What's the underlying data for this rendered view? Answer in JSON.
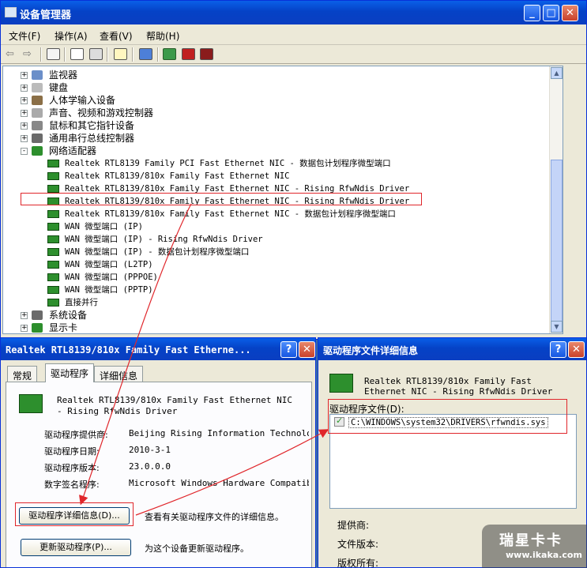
{
  "devmgr": {
    "title": "设备管理器",
    "menus": [
      "文件(F)",
      "操作(A)",
      "查看(V)",
      "帮助(H)"
    ],
    "tree": [
      {
        "label": "监视器",
        "expander": "+"
      },
      {
        "label": "键盘",
        "expander": "+"
      },
      {
        "label": "人体学输入设备",
        "expander": "+"
      },
      {
        "label": "声音、视频和游戏控制器",
        "expander": "+"
      },
      {
        "label": "鼠标和其它指针设备",
        "expander": "+"
      },
      {
        "label": "通用串行总线控制器",
        "expander": "+"
      },
      {
        "label": "网络适配器",
        "expander": "-"
      },
      {
        "label": "Realtek RTL8139 Family PCI Fast Ethernet NIC - 数据包计划程序微型端口"
      },
      {
        "label": "Realtek RTL8139/810x Family Fast Ethernet NIC"
      },
      {
        "label": "Realtek RTL8139/810x Family Fast Ethernet NIC - Rising RfwNdis Driver"
      },
      {
        "label": "Realtek RTL8139/810x Family Fast Ethernet NIC - Rising RfwNdis Driver"
      },
      {
        "label": "Realtek RTL8139/810x Family Fast Ethernet NIC - 数据包计划程序微型端口"
      },
      {
        "label": "WAN 微型端口 (IP)"
      },
      {
        "label": "WAN 微型端口 (IP) - Rising RfwNdis Driver"
      },
      {
        "label": "WAN 微型端口 (IP) - 数据包计划程序微型端口"
      },
      {
        "label": "WAN 微型端口 (L2TP)"
      },
      {
        "label": "WAN 微型端口 (PPPOE)"
      },
      {
        "label": "WAN 微型端口 (PPTP)"
      },
      {
        "label": "直接并行"
      },
      {
        "label": "系统设备",
        "expander": "+"
      },
      {
        "label": "显示卡",
        "expander": "+"
      }
    ]
  },
  "props": {
    "title": "Realtek RTL8139/810x Family Fast Etherne...",
    "tabs": [
      "常规",
      "驱动程序",
      "详细信息"
    ],
    "device_name": "Realtek RTL8139/810x Family Fast Ethernet NIC - Rising RfwNdis Driver",
    "fields": [
      {
        "label": "驱动程序提供商:",
        "value": "Beijing Rising Information Technology"
      },
      {
        "label": "驱动程序日期:",
        "value": "2010-3-1"
      },
      {
        "label": "驱动程序版本:",
        "value": "23.0.0.0"
      },
      {
        "label": "数字签名程序:",
        "value": "Microsoft Windows Hardware Compatibili"
      }
    ],
    "details_button": "驱动程序详细信息(D)...",
    "details_desc": "查看有关驱动程序文件的详细信息。",
    "update_button": "更新驱动程序(P)...",
    "update_desc": "为这个设备更新驱动程序。"
  },
  "filedetails": {
    "title": "驱动程序文件详细信息",
    "device_name": "Realtek RTL8139/810x Family Fast Ethernet NIC - Rising RfwNdis Driver",
    "files_label": "驱动程序文件(D):",
    "files": [
      "C:\\WINDOWS\\system32\\DRIVERS\\rfwndis.sys"
    ],
    "info": [
      "提供商:",
      "文件版本:",
      "版权所有:"
    ]
  },
  "watermark": {
    "brand": "瑞星卡卡",
    "url": "www.ikaka.com"
  },
  "colors": {
    "highlight": "#e0262b",
    "titlebar": "#0a5fe8",
    "window": "#ece9d8"
  }
}
